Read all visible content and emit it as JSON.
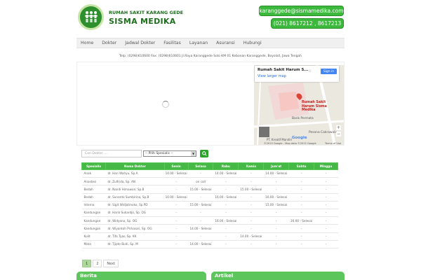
{
  "brand": {
    "subtitle": "RUMAH SAKIT KARANG GEDE",
    "title": "SISMA MEDIKA",
    "logo_icon": "people-group-icon",
    "accent_color": "#3cb93c"
  },
  "contact": {
    "email": "karanggede@sismamedika.com",
    "phone": "(021) 8617212 , 8617213"
  },
  "nav": {
    "items": [
      "Home",
      "Dokter",
      "Jadwal Dokter",
      "Fasilitas",
      "Layanan",
      "Asuransi",
      "Hubungi"
    ]
  },
  "address": "Telp: (0298)610600 Fax: (0298)610601 Jl.Raya Karanggede Solo KM 01 Kebonan Karanggede, Boyolali, Jawa Tengah",
  "map": {
    "place_name": "Rumah Sakit Harum S...",
    "view_larger": "View larger map",
    "sign_in": "Sign in",
    "marker_label": "Rumah Sakit Harum Sisma Medika",
    "bank_label": "Bank Permata",
    "cakrawala_label": "Pesona Cakrawala",
    "kreatif_label": "PT. Kreatif Mandiri",
    "google": "Google",
    "footer": "©2015 Google - Map data ©2015 Google",
    "terms": "Terms of Use",
    "zoom_in": "+",
    "zoom_out": "−"
  },
  "filter": {
    "doctor_placeholder": "Cari Dokter ....",
    "spesialis_value": "-- Pilih Spesialis --",
    "search_icon": "search-icon"
  },
  "schedule": {
    "headers": [
      "Spesialis",
      "Nama Dokter",
      "Senin",
      "Selasa",
      "Rabu",
      "Kamis",
      "Jum'at",
      "Sabtu",
      "Minggu"
    ],
    "rows": [
      [
        "Anak",
        "dr. Hari Wahyu, Sp.A",
        "14.00 - Selesai",
        "-",
        "14.00 - Selesai",
        "-",
        "14.00 - Selesai",
        "-",
        "-"
      ],
      [
        "Anastesi",
        "dr. Zulfrida, Sp. AN",
        "-",
        "on call",
        "-",
        "-",
        "-",
        "-",
        "-"
      ],
      [
        "Bedah",
        "dr. Nandi Himawan, Sp.B",
        "-",
        "15.00 - Selesai",
        "-",
        "15.00 - Selesai",
        "-",
        "-",
        "-"
      ],
      [
        "Bedah",
        "dr. Sunardo Sumbirina, Sp.B",
        "10.00 - Selesai",
        "-",
        "16.00 - Selesai",
        "-",
        "16.00 - Selesai",
        "-",
        "-"
      ],
      [
        "Interna",
        "dr. Sigit Widjatmoko, Sp.PD",
        "-",
        "15.00 - Selesai",
        "-",
        "-",
        "15.00 - Selesai",
        "-",
        "-"
      ],
      [
        "Kandungan",
        "dr. Hario Sukardjo, Sp. OG",
        "-",
        "-",
        "-",
        "-",
        "-",
        "-",
        "-"
      ],
      [
        "Kandungan",
        "dr. Widyono, Sp. OG",
        "-",
        "-",
        "16.00 - Selesai",
        "-",
        "-",
        "16.00 - Selesai",
        "-"
      ],
      [
        "Kandungan",
        "dr. Wiyantoh Prihasari, Sp. OG",
        "-",
        "14.00 - Selesai",
        "-",
        "-",
        "-",
        "-",
        "-"
      ],
      [
        "Kulit",
        "dr. Tifo Tyas, Sp. KK",
        "-",
        "-",
        "-",
        "14.00 - Selesai",
        "-",
        "-",
        "-"
      ],
      [
        "Mata",
        "dr. Tjipto Budi, Sp. M",
        "-",
        "14.00 - Selesai",
        "-",
        "-",
        "-",
        "-",
        "-"
      ]
    ]
  },
  "pagination": {
    "pages": [
      "1",
      "2"
    ],
    "next": "Next"
  },
  "panels": {
    "berita": "Berita",
    "artikel": "Artikel"
  }
}
